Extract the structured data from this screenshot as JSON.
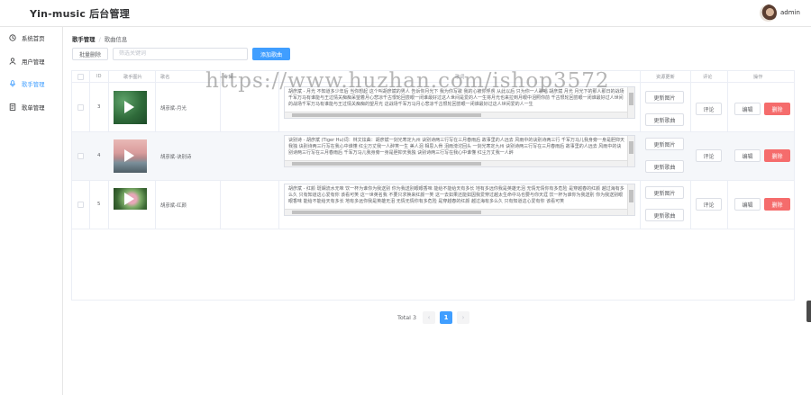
{
  "app": {
    "title": "Yin-music 后台管理",
    "user": "admin"
  },
  "sidebar": {
    "items": [
      {
        "label": "系统首页",
        "icon": "monitor-icon",
        "active": false
      },
      {
        "label": "用户管理",
        "icon": "user-icon",
        "active": false
      },
      {
        "label": "歌手管理",
        "icon": "microphone-icon",
        "active": true
      },
      {
        "label": "歌单管理",
        "icon": "document-icon",
        "active": false
      }
    ]
  },
  "breadcrumb": {
    "parent": "歌手管理",
    "separator": "/",
    "current": "歌曲信息"
  },
  "toolbar": {
    "batch_delete": "批量删除",
    "search_placeholder": "筛选关键词",
    "add_song": "添加歌曲"
  },
  "table": {
    "columns": [
      "ID",
      "歌手图片",
      "歌名",
      "专辑",
      "歌词",
      "资源更新",
      "评论",
      "操作"
    ],
    "rows": [
      {
        "id": "3",
        "name": "胡彦斌-月光",
        "album": "",
        "lyrics": "胡彦斌 - 月光 不知道多少年后 当你想起 这个叫胡彦斌的男人 告诉你月光下 我为你写歌 我的心被你俘虏 从此以后 只为你一人歌唱 胡彦斌 月光 月光下的那人那日的战场千军万马有谁能与王过情关痴痴呆望着月心悲凉千古恨轮回尝眼一闭谁最好过这人世间是爱的人一生将月光也来拉到月眼中泪照你前 千古恨轮回尝眼一闭谁最好过人世间 的战场千军万马有谁能与王过情关痴痴的望月光 这战场千军万马月心悲凉千古恨轮回尝眼一闭谁最好过这人世间爱的人一生",
        "btn_update_image": "更新图片",
        "btn_update_song": "更新歌曲",
        "btn_comment": "评论",
        "btn_edit": "编辑",
        "btn_delete": "删除"
      },
      {
        "id": "4",
        "name": "胡彦斌-诀别诗",
        "album": "",
        "lyrics": "诀别诗 - 胡彦斌 (Tiger Hu)词：林文炫曲：胡彦斌一剑光寒定九州 诀别诗两三行写在三月春雨后 故事里的人远去 风雨中的诀别诗两三行 千军万马儿我身旁一身是胆抑天我独 诀别诗两三行写在我心中谁懂 红尘万丈我一人醉笑一生 美人泪 相思入骨 泪雨滂沱回头 一剑光寒定九州 诀别诗两三行写在三月春雨后 故事里的人远去 风雨中的诀别诗两三行写在三月春雨后 千军万马儿我身旁一身是胆抑天我独 诀别诗两三行写在我心中谁懂 红尘万丈我一人醉",
        "btn_update_image": "更新图片",
        "btn_update_song": "更新歌曲",
        "btn_comment": "评论",
        "btn_edit": "编辑",
        "btn_delete": "删除"
      },
      {
        "id": "5",
        "name": "胡彦斌-红颜",
        "album": "",
        "lyrics": "胡彦斌 - 红颜 斑斓流水无味 饮一杯为谁你为我送别 你为我送别眼眼香味 能给不能给天有多长 地有多远你我是英雄无泪 无情无情你有多危险 是穿越春的红颜 越过海有多么久 只有知道这心爱有你 该看可笑 这一世英名我 不要只求换来红颜一笑 这一去如果还能如因我爱穿过越太生命中马也要与你天涯 饮一杯为谁你为我送别 你为我送别眼眼香味 能给不能给天有多长 地有多远你我是英雄无泪 无情无情你有多危险 是穿越春的红颜 越过海有多么久 只有知道这心爱有你 该看可笑",
        "btn_update_image": "更新图片",
        "btn_update_song": "更新歌曲",
        "btn_comment": "评论",
        "btn_edit": "编辑",
        "btn_delete": "删除"
      }
    ]
  },
  "pagination": {
    "total": "Total 3",
    "current": "1",
    "prev": "‹",
    "next": "›"
  },
  "watermark": "https://www.huzhan.com/ishop3572",
  "colors": {
    "primary": "#409eff",
    "danger": "#f56c6c"
  }
}
